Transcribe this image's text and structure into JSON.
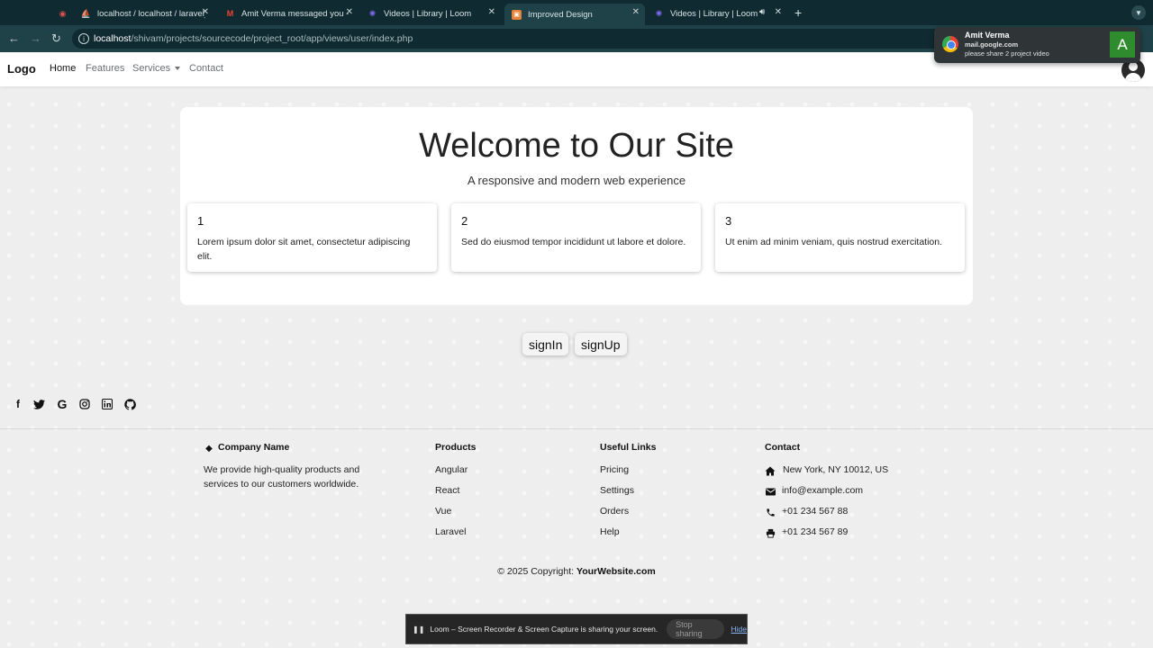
{
  "browser": {
    "tabs": [
      {
        "label": "",
        "icon": "record-icon"
      },
      {
        "label": "localhost / localhost / laravel_",
        "icon": "phpmyadmin-icon"
      },
      {
        "label": "Amit Verma messaged you - (",
        "icon": "gmail-icon"
      },
      {
        "label": "Videos | Library | Loom",
        "icon": "loom-icon"
      },
      {
        "label": "Improved Design",
        "icon": "page-icon"
      },
      {
        "label": "Videos | Library | Loom",
        "icon": "loom-icon"
      }
    ],
    "url_host": "localhost",
    "url_path": "/shivam/projects/sourcecode/project_root/app/views/user/index.php"
  },
  "notification": {
    "sender": "Amit Verma",
    "source": "mail.google.com",
    "message": "please share 2 project video",
    "avatar_letter": "A"
  },
  "navbar": {
    "brand": "Logo",
    "links": [
      "Home",
      "Features",
      "Services",
      "Contact"
    ]
  },
  "hero": {
    "title": "Welcome to Our Site",
    "subtitle": "A responsive and modern web experience",
    "cards": [
      {
        "num": "1",
        "text": "Lorem ipsum dolor sit amet, consectetur adipiscing elit."
      },
      {
        "num": "2",
        "text": "Sed do eiusmod tempor incididunt ut labore et dolore."
      },
      {
        "num": "3",
        "text": "Ut enim ad minim veniam, quis nostrud exercitation."
      }
    ]
  },
  "auth": {
    "signin": "signIn",
    "signup": "signUp"
  },
  "social_icons": [
    "facebook-icon",
    "twitter-icon",
    "google-icon",
    "instagram-icon",
    "linkedin-icon",
    "github-icon"
  ],
  "footer": {
    "company": {
      "name": "Company Name",
      "description": "We provide high-quality products and services to our customers worldwide."
    },
    "products": {
      "heading": "Products",
      "items": [
        "Angular",
        "React",
        "Vue",
        "Laravel"
      ]
    },
    "useful_links": {
      "heading": "Useful Links",
      "items": [
        "Pricing",
        "Settings",
        "Orders",
        "Help"
      ]
    },
    "contact": {
      "heading": "Contact",
      "address": "New York, NY 10012, US",
      "email": "info@example.com",
      "phone": "+01 234 567 88",
      "fax": "+01 234 567 89"
    },
    "copyright_prefix": "© 2025 Copyright:",
    "copyright_site": "YourWebsite.com"
  },
  "loom": {
    "message": "Loom – Screen Recorder & Screen Capture is sharing your screen.",
    "stop": "Stop sharing",
    "hide": "Hide"
  }
}
